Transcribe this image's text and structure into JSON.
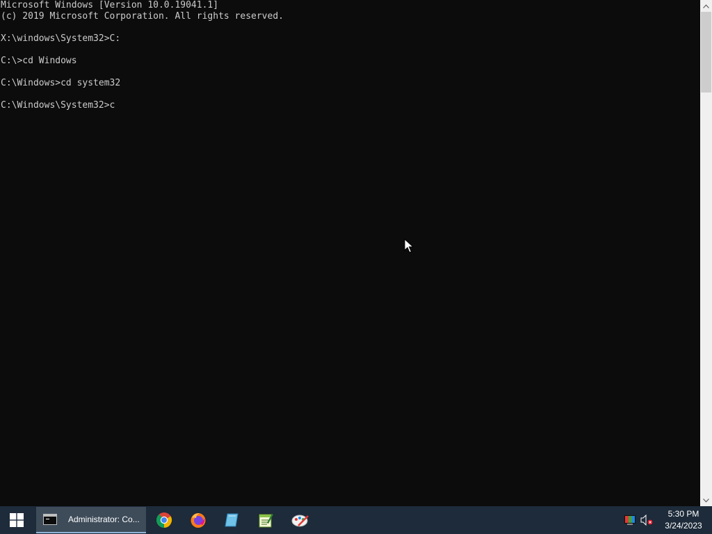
{
  "console": {
    "lines": [
      "Microsoft Windows [Version 10.0.19041.1]",
      "(c) 2019 Microsoft Corporation. All rights reserved.",
      "",
      "X:\\windows\\System32>C:",
      "",
      "C:\\>cd Windows",
      "",
      "C:\\Windows>cd system32",
      "",
      "C:\\Windows\\System32>c"
    ],
    "text_color": "#cccccc",
    "background_color": "#0c0c0c"
  },
  "taskbar": {
    "background_color": "#1d2b3a",
    "start_icon": "windows-logo-icon",
    "active_task": {
      "label": "Administrator: Co...",
      "icon": "command-prompt-icon"
    },
    "pinned": [
      {
        "name": "chrome",
        "icon": "chrome-icon"
      },
      {
        "name": "firefox",
        "icon": "firefox-icon"
      },
      {
        "name": "file-explorer-blue",
        "icon": "blue-document-icon"
      },
      {
        "name": "notepad-plus",
        "icon": "green-notepad-icon"
      },
      {
        "name": "paint",
        "icon": "paint-palette-icon"
      }
    ],
    "tray": {
      "icons": [
        "color-display-icon",
        "volume-muted-icon"
      ],
      "time": "5:30 PM",
      "date": "3/24/2023"
    }
  }
}
